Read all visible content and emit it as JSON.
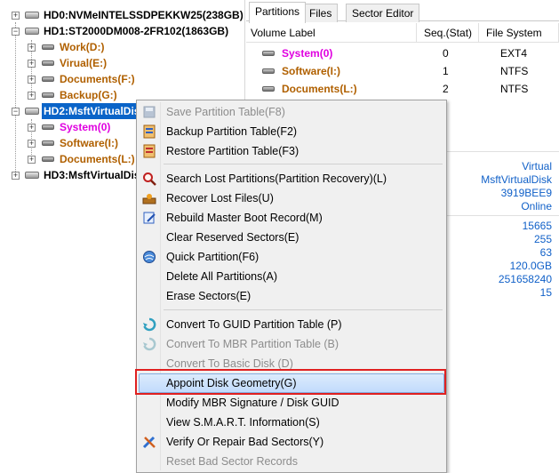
{
  "tree": {
    "disks": [
      {
        "label": "HD0:NVMeINTELSSDPEKKW25(238GB)"
      },
      {
        "label": "HD1:ST2000DM008-2FR102(1863GB)"
      },
      {
        "label": "HD2:MsftVirtualDis"
      },
      {
        "label": "HD3:MsftVirtualDis"
      }
    ],
    "hd1_parts": [
      "Work(D:)",
      "Virual(E:)",
      "Documents(F:)",
      "Backup(G:)"
    ],
    "hd2_parts": [
      "System(0)",
      "Software(I:)",
      "Documents(L:)"
    ]
  },
  "tabs": [
    "Partitions",
    "Files",
    "Sector Editor"
  ],
  "partitions": {
    "headers": [
      "Volume Label",
      "Seq.(Stat)",
      "File System"
    ],
    "rows": [
      {
        "label": "System(0)",
        "seq": "0",
        "fs": "EXT4"
      },
      {
        "label": "Software(I:)",
        "seq": "1",
        "fs": "NTFS"
      },
      {
        "label": "Documents(L:)",
        "seq": "2",
        "fs": "NTFS"
      }
    ]
  },
  "info": {
    "group1": [
      "Virtual",
      "MsftVirtualDisk",
      "3919BEE9",
      "Online"
    ],
    "group2": [
      "15665",
      "255",
      "63",
      "120.0GB",
      "251658240",
      "15"
    ]
  },
  "menu": {
    "items": [
      {
        "label": "Save Partition Table(F8)",
        "disabled": true,
        "icon": "save-icon"
      },
      {
        "label": "Backup Partition Table(F2)",
        "disabled": false,
        "icon": "backup-icon"
      },
      {
        "label": "Restore Partition Table(F3)",
        "disabled": false,
        "icon": ""
      },
      {
        "label": "Search Lost Partitions(Partition Recovery)(L)",
        "disabled": false,
        "icon": "magnifier-icon"
      },
      {
        "label": "Recover Lost Files(U)",
        "disabled": false,
        "icon": "recover-icon"
      },
      {
        "label": "Rebuild Master Boot Record(M)",
        "disabled": false,
        "icon": "edit-icon"
      },
      {
        "label": "Clear Reserved Sectors(E)",
        "disabled": false,
        "icon": ""
      },
      {
        "label": "Quick Partition(F6)",
        "disabled": false,
        "icon": "globe-icon"
      },
      {
        "label": "Delete All Partitions(A)",
        "disabled": false,
        "icon": ""
      },
      {
        "label": "Erase Sectors(E)",
        "disabled": false,
        "icon": ""
      },
      {
        "label": "Convert To GUID Partition Table (P)",
        "disabled": false,
        "icon": "convert-icon"
      },
      {
        "label": "Convert To MBR Partition Table (B)",
        "disabled": true,
        "icon": "convert-icon"
      },
      {
        "label": "Convert To Basic Disk (D)",
        "disabled": true,
        "icon": ""
      },
      {
        "label": "Appoint Disk Geometry(G)",
        "disabled": false,
        "icon": ""
      },
      {
        "label": "Modify MBR Signature / Disk GUID",
        "disabled": false,
        "icon": ""
      },
      {
        "label": "View S.M.A.R.T. Information(S)",
        "disabled": false,
        "icon": ""
      },
      {
        "label": "Verify Or Repair Bad Sectors(Y)",
        "disabled": false,
        "icon": "tools-icon"
      },
      {
        "label": "Reset Bad Sector Records",
        "disabled": true,
        "icon": ""
      }
    ],
    "highlighted": "Appoint Disk Geometry(G)"
  },
  "colors": {
    "selection": "#0a64c8",
    "partition_text": "#b06000",
    "system_text": "#e000e0",
    "info_text": "#1060c8",
    "callout": "#e02020"
  }
}
